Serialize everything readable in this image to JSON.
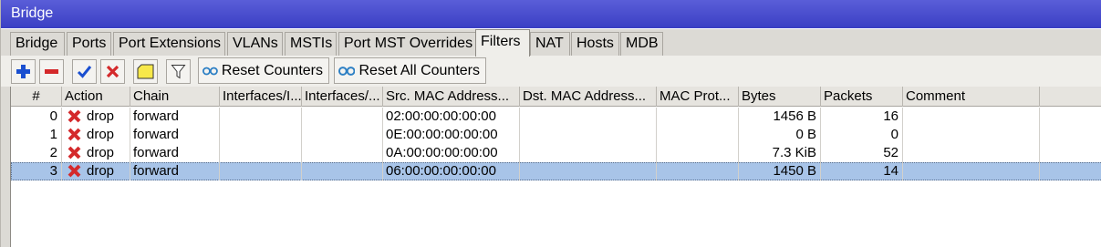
{
  "window": {
    "title": "Bridge"
  },
  "tabs": [
    {
      "label": "Bridge"
    },
    {
      "label": "Ports"
    },
    {
      "label": "Port Extensions"
    },
    {
      "label": "VLANs"
    },
    {
      "label": "MSTIs"
    },
    {
      "label": "Port MST Overrides"
    },
    {
      "label": "Filters",
      "active": true
    },
    {
      "label": "NAT"
    },
    {
      "label": "Hosts"
    },
    {
      "label": "MDB"
    }
  ],
  "toolbar": {
    "add_icon": "plus-icon",
    "remove_icon": "minus-icon",
    "enable_icon": "check-icon",
    "disable_icon": "cross-icon",
    "comment_icon": "comment-icon",
    "filter_icon": "funnel-icon",
    "reset_counters": "Reset Counters",
    "reset_all_counters": "Reset All Counters"
  },
  "columns": {
    "num": "#",
    "action": "Action",
    "chain": "Chain",
    "in_iface": "Interfaces/I...",
    "out_iface": "Interfaces/...",
    "src_mac": "Src. MAC Address...",
    "dst_mac": "Dst. MAC Address...",
    "mac_proto": "MAC Prot...",
    "bytes": "Bytes",
    "packets": "Packets",
    "comment": "Comment"
  },
  "rows": [
    {
      "num": "0",
      "action": "drop",
      "chain": "forward",
      "in_iface": "",
      "out_iface": "",
      "src_mac": "02:00:00:00:00:00",
      "dst_mac": "",
      "mac_proto": "",
      "bytes": "1456 B",
      "packets": "16",
      "comment": ""
    },
    {
      "num": "1",
      "action": "drop",
      "chain": "forward",
      "in_iface": "",
      "out_iface": "",
      "src_mac": "0E:00:00:00:00:00",
      "dst_mac": "",
      "mac_proto": "",
      "bytes": "0 B",
      "packets": "0",
      "comment": ""
    },
    {
      "num": "2",
      "action": "drop",
      "chain": "forward",
      "in_iface": "",
      "out_iface": "",
      "src_mac": "0A:00:00:00:00:00",
      "dst_mac": "",
      "mac_proto": "",
      "bytes": "7.3 KiB",
      "packets": "52",
      "comment": ""
    },
    {
      "num": "3",
      "action": "drop",
      "chain": "forward",
      "in_iface": "",
      "out_iface": "",
      "src_mac": "06:00:00:00:00:00",
      "dst_mac": "",
      "mac_proto": "",
      "bytes": "1450 B",
      "packets": "14",
      "comment": "",
      "selected": true
    }
  ],
  "colors": {
    "title_bar": "#3a3fc4",
    "selected_row": "#a8c4e8",
    "drop_icon": "#d4292b",
    "accent_blue": "#1a4fd0"
  }
}
